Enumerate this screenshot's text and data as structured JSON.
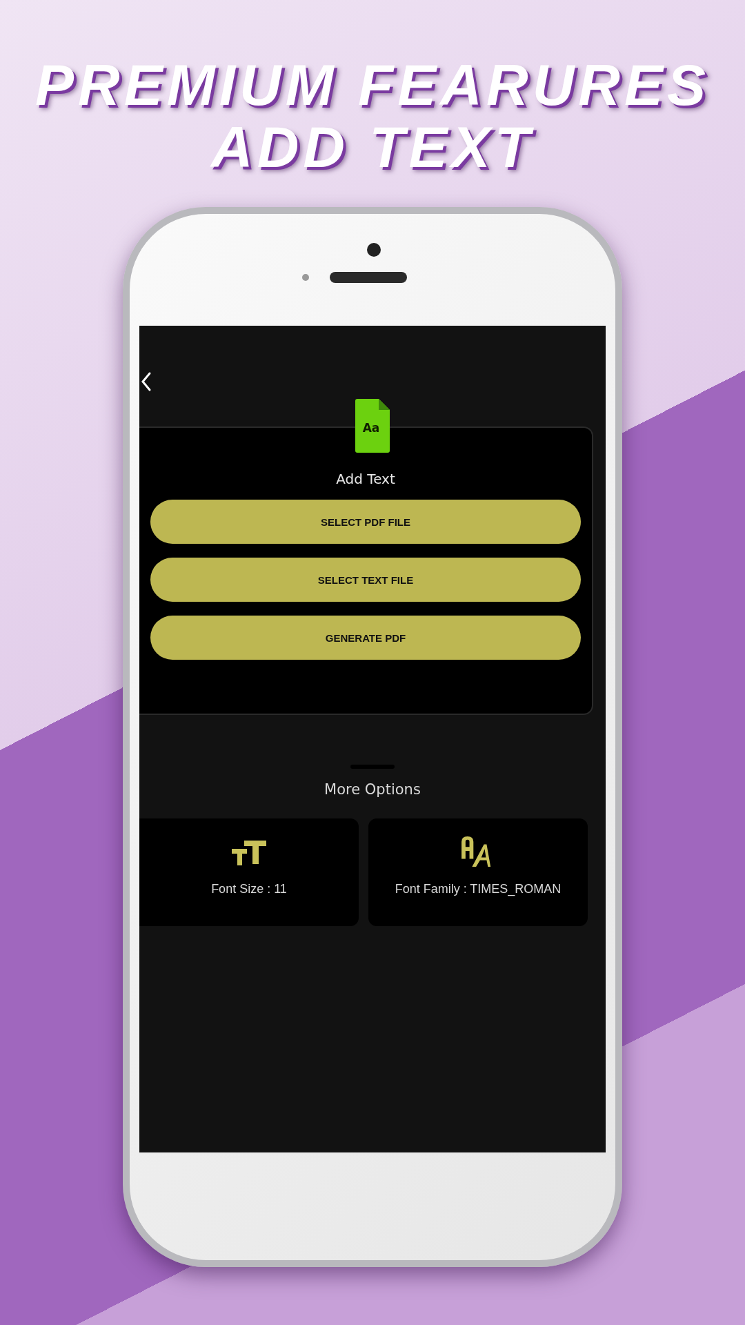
{
  "headline": {
    "lines": [
      "PREMIUM FEARURES",
      "ADD TEXT"
    ]
  },
  "screen": {
    "tool": {
      "icon_label": "Aa",
      "title": "Add Text"
    },
    "buttons": [
      "SELECT PDF FILE",
      "SELECT TEXT FILE",
      "GENERATE PDF"
    ],
    "more_options": {
      "title": "More Options",
      "options": [
        {
          "kind": "font-size",
          "label": "Font Size : 11"
        },
        {
          "kind": "font-family",
          "label": "Font Family : TIMES_ROMAN"
        }
      ]
    }
  }
}
